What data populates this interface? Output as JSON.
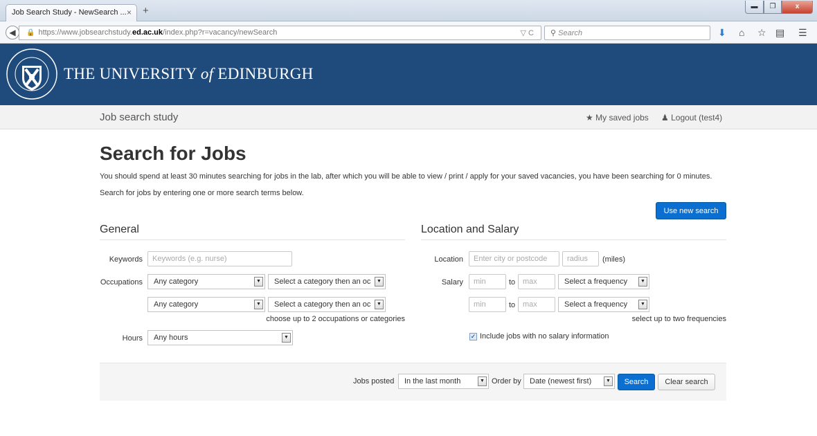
{
  "browser": {
    "tab_title": "Job Search Study - NewSearch ...",
    "tab_close": "×",
    "new_tab": "+",
    "window_buttons": {
      "minimize": "▬",
      "maximize": "❐",
      "close": "x"
    },
    "url_prefix": "https://www.jobsearchstudy.",
    "url_domain": "ed.ac.uk",
    "url_path": "/index.php?r=vacancy/newSearch",
    "url_right": "▽ C",
    "search_placeholder": "Search"
  },
  "header": {
    "university_prefix": "THE UNIVERSITY ",
    "university_of": "of",
    "university_suffix": " EDINBURGH"
  },
  "subnav": {
    "site_title": "Job search study",
    "saved_jobs": "My saved jobs",
    "logout": "Logout (test4)"
  },
  "page": {
    "title": "Search for Jobs",
    "intro": "You should spend at least 30 minutes searching for jobs in the lab, after which you will be able to view / print / apply for your saved vacancies, you have been searching for 0 minutes.",
    "intro2": "Search for jobs by entering one or more search terms below.",
    "use_new_search": "Use new search"
  },
  "general": {
    "title": "General",
    "keywords_label": "Keywords",
    "keywords_placeholder": "Keywords (e.g. nurse)",
    "occupations_label": "Occupations",
    "occupation_rows": [
      {
        "category": "Any category",
        "occupation": "Select a category then an oc"
      },
      {
        "category": "Any category",
        "occupation": "Select a category then an oc"
      }
    ],
    "occupations_hint": "choose up to 2 occupations or categories",
    "hours_label": "Hours",
    "hours_value": "Any hours"
  },
  "location": {
    "title": "Location and Salary",
    "location_label": "Location",
    "location_placeholder": "Enter city or postcode",
    "radius_placeholder": "radius",
    "miles": "(miles)",
    "salary_label": "Salary",
    "salary_rows": [
      {
        "min": "min",
        "to": "to",
        "max": "max",
        "frequency": "Select a frequency"
      },
      {
        "min": "min",
        "to": "to",
        "max": "max",
        "frequency": "Select a frequency"
      }
    ],
    "frequency_hint": "select up to two frequencies",
    "include_no_salary": "Include jobs with no salary information",
    "include_no_salary_checked": true
  },
  "footer_form": {
    "jobs_posted_label": "Jobs posted",
    "jobs_posted_value": "In the last month",
    "order_by_label": "Order by",
    "order_by_value": "Date (newest first)",
    "search_button": "Search",
    "clear_button": "Clear search"
  },
  "colors": {
    "header_blue": "#1f4a7c",
    "button_blue": "#0a6fd1"
  }
}
